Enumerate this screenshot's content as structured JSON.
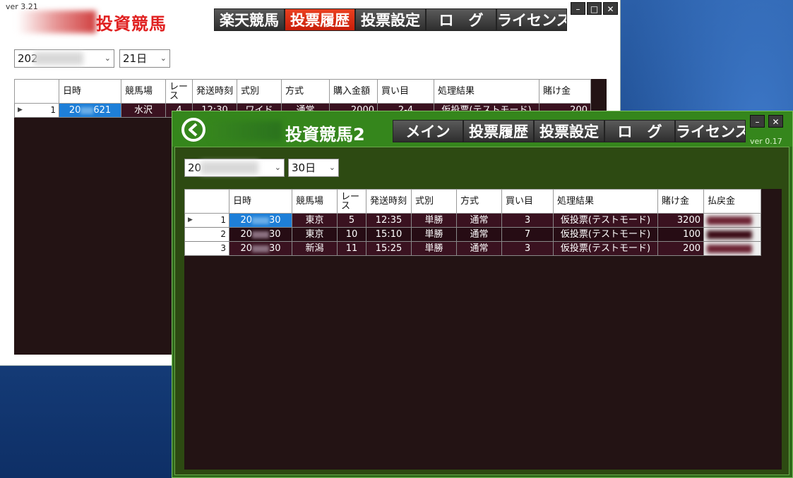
{
  "win1": {
    "version": "ver 3.21",
    "title": "投資競馬",
    "nav": [
      "楽天競馬",
      "投票履歴",
      "投票設定",
      "ロ　グ",
      "ライセンス"
    ],
    "active_nav": 1,
    "window_controls": [
      "–",
      "□",
      "✕"
    ],
    "date_select": "202",
    "day_select": "21日",
    "columns": [
      "日時",
      "競馬場",
      "レース",
      "発送時刻",
      "式別",
      "方式",
      "購入金額",
      "買い目",
      "処理結果",
      "賭け金"
    ],
    "rows": [
      {
        "no": "1",
        "datetime": "20",
        "datetime_tail": "621",
        "venue": "水沢",
        "race": "4",
        "time": "12:30",
        "type": "ワイド",
        "method": "通常",
        "amount": "2000",
        "picks": "2-4",
        "result": "仮投票(テストモード)",
        "bet": "200"
      }
    ]
  },
  "win2": {
    "version": "ver 0.17",
    "title": "投資競馬2",
    "nav": [
      "メイン",
      "投票履歴",
      "投票設定",
      "ロ　グ",
      "ライセンス"
    ],
    "window_controls": [
      "–",
      "✕"
    ],
    "date_select": "20",
    "day_select": "30日",
    "columns": [
      "日時",
      "競馬場",
      "レース",
      "発送時刻",
      "式別",
      "方式",
      "買い目",
      "処理結果",
      "賭け金",
      "払戻金"
    ],
    "rows": [
      {
        "no": "1",
        "datetime": "20",
        "datetime_tail": "30",
        "venue": "東京",
        "race": "5",
        "time": "12:35",
        "type": "単勝",
        "method": "通常",
        "picks": "3",
        "result": "仮投票(テストモード)",
        "bet": "3200"
      },
      {
        "no": "2",
        "datetime": "20",
        "datetime_tail": "30",
        "venue": "東京",
        "race": "10",
        "time": "15:10",
        "type": "単勝",
        "method": "通常",
        "picks": "7",
        "result": "仮投票(テストモード)",
        "bet": "100"
      },
      {
        "no": "3",
        "datetime": "20",
        "datetime_tail": "30",
        "venue": "新潟",
        "race": "11",
        "time": "15:25",
        "type": "単勝",
        "method": "通常",
        "picks": "3",
        "result": "仮投票(テストモード)",
        "bet": "200"
      }
    ]
  },
  "colors": {
    "win1_accent": "#e02020",
    "win2_bar": "#35861c",
    "grid_bg": "#231314",
    "selected": "#1e7fd8"
  },
  "icons": {
    "row_pointer": "triangle-right-icon",
    "win2_logo": "horseshoe-logo-icon"
  }
}
